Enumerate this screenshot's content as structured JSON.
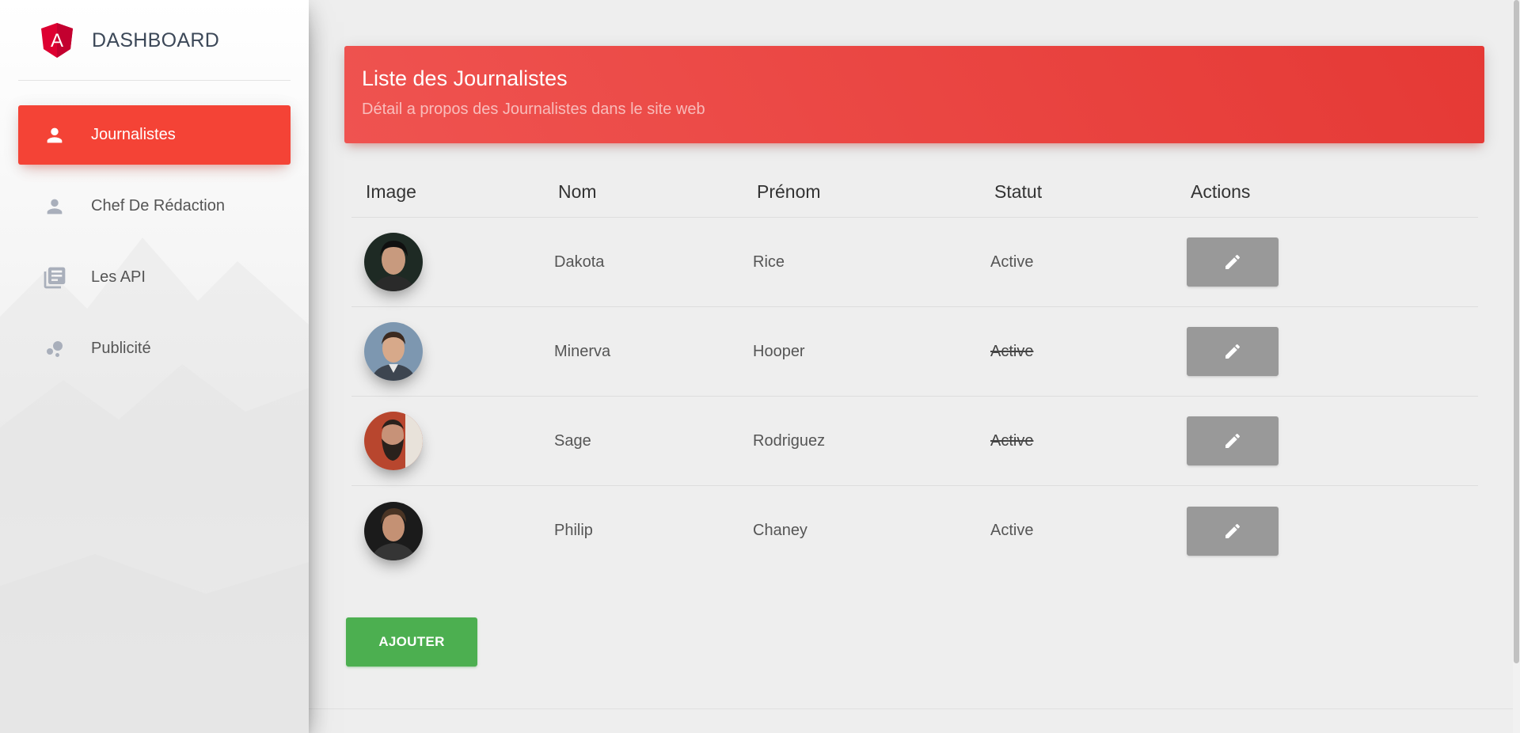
{
  "sidebar": {
    "logo_text": "DASHBOARD",
    "logo_letter": "A",
    "items": [
      {
        "label": "Journalistes",
        "icon": "person-icon",
        "active": true
      },
      {
        "label": "Chef De Rédaction",
        "icon": "person-icon",
        "active": false
      },
      {
        "label": "Les API",
        "icon": "library-books-icon",
        "active": false
      },
      {
        "label": "Publicité",
        "icon": "bubble-chart-icon",
        "active": false
      }
    ]
  },
  "header": {
    "title": "Liste des Journalistes",
    "subtitle": "Détail a propos des Journalistes dans le site web"
  },
  "table": {
    "columns": [
      "Image",
      "Nom",
      "Prénom",
      "Statut",
      "Actions"
    ],
    "rows": [
      {
        "nom": "Dakota",
        "prenom": "Rice",
        "statut": "Active",
        "statut_struck": false
      },
      {
        "nom": "Minerva",
        "prenom": "Hooper",
        "statut": "Active",
        "statut_struck": true
      },
      {
        "nom": "Sage",
        "prenom": "Rodriguez",
        "statut": "Active",
        "statut_struck": true
      },
      {
        "nom": "Philip",
        "prenom": "Chaney",
        "statut": "Active",
        "statut_struck": false
      }
    ]
  },
  "actions": {
    "add_label": "AJOUTER"
  },
  "colors": {
    "accent": "#f44336",
    "header_gradient": [
      "#ef5350",
      "#e53935"
    ],
    "edit_button": "#999999",
    "add_button": "#4caf50",
    "logo": "#dd0031"
  }
}
